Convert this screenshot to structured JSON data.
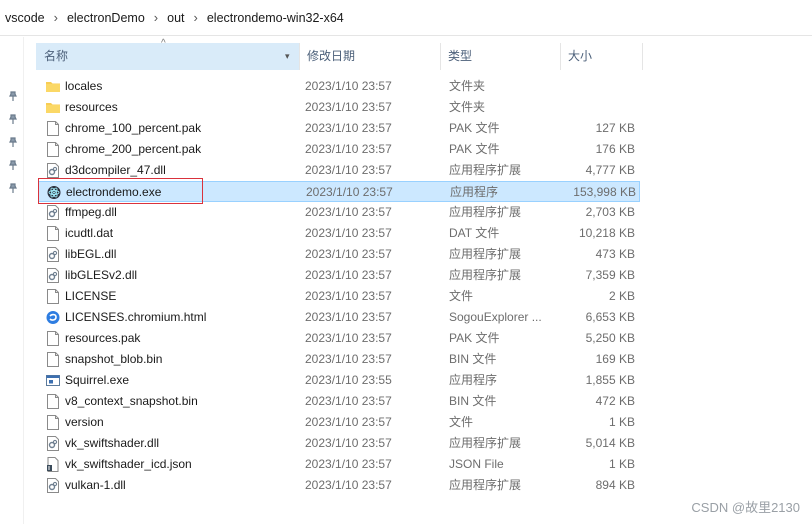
{
  "breadcrumb": [
    "vscode",
    "electronDemo",
    "out",
    "electrondemo-win32-x64"
  ],
  "breadcrumb_separator": "›",
  "header": {
    "name": "名称",
    "date": "修改日期",
    "type": "类型",
    "size": "大小"
  },
  "files": [
    {
      "name": "locales",
      "date": "2023/1/10 23:57",
      "type": "文件夹",
      "size": "",
      "icon": "folder-icon"
    },
    {
      "name": "resources",
      "date": "2023/1/10 23:57",
      "type": "文件夹",
      "size": "",
      "icon": "folder-icon"
    },
    {
      "name": "chrome_100_percent.pak",
      "date": "2023/1/10 23:57",
      "type": "PAK 文件",
      "size": "127 KB",
      "icon": "file-icon"
    },
    {
      "name": "chrome_200_percent.pak",
      "date": "2023/1/10 23:57",
      "type": "PAK 文件",
      "size": "176 KB",
      "icon": "file-icon"
    },
    {
      "name": "d3dcompiler_47.dll",
      "date": "2023/1/10 23:57",
      "type": "应用程序扩展",
      "size": "4,777 KB",
      "icon": "dll-icon"
    },
    {
      "name": "electrondemo.exe",
      "date": "2023/1/10 23:57",
      "type": "应用程序",
      "size": "153,998 KB",
      "icon": "electron-app-icon",
      "selected": true
    },
    {
      "name": "ffmpeg.dll",
      "date": "2023/1/10 23:57",
      "type": "应用程序扩展",
      "size": "2,703 KB",
      "icon": "dll-icon"
    },
    {
      "name": "icudtl.dat",
      "date": "2023/1/10 23:57",
      "type": "DAT 文件",
      "size": "10,218 KB",
      "icon": "file-icon"
    },
    {
      "name": "libEGL.dll",
      "date": "2023/1/10 23:57",
      "type": "应用程序扩展",
      "size": "473 KB",
      "icon": "dll-icon"
    },
    {
      "name": "libGLESv2.dll",
      "date": "2023/1/10 23:57",
      "type": "应用程序扩展",
      "size": "7,359 KB",
      "icon": "dll-icon"
    },
    {
      "name": "LICENSE",
      "date": "2023/1/10 23:57",
      "type": "文件",
      "size": "2 KB",
      "icon": "file-icon"
    },
    {
      "name": "LICENSES.chromium.html",
      "date": "2023/1/10 23:57",
      "type": "SogouExplorer ...",
      "size": "6,653 KB",
      "icon": "browser-icon"
    },
    {
      "name": "resources.pak",
      "date": "2023/1/10 23:57",
      "type": "PAK 文件",
      "size": "5,250 KB",
      "icon": "file-icon"
    },
    {
      "name": "snapshot_blob.bin",
      "date": "2023/1/10 23:57",
      "type": "BIN 文件",
      "size": "169 KB",
      "icon": "file-icon"
    },
    {
      "name": "Squirrel.exe",
      "date": "2023/1/10 23:55",
      "type": "应用程序",
      "size": "1,855 KB",
      "icon": "exe-icon"
    },
    {
      "name": "v8_context_snapshot.bin",
      "date": "2023/1/10 23:57",
      "type": "BIN 文件",
      "size": "472 KB",
      "icon": "file-icon"
    },
    {
      "name": "version",
      "date": "2023/1/10 23:57",
      "type": "文件",
      "size": "1 KB",
      "icon": "file-icon"
    },
    {
      "name": "vk_swiftshader.dll",
      "date": "2023/1/10 23:57",
      "type": "应用程序扩展",
      "size": "5,014 KB",
      "icon": "dll-icon"
    },
    {
      "name": "vk_swiftshader_icd.json",
      "date": "2023/1/10 23:57",
      "type": "JSON File",
      "size": "1 KB",
      "icon": "json-icon"
    },
    {
      "name": "vulkan-1.dll",
      "date": "2023/1/10 23:57",
      "type": "应用程序扩展",
      "size": "894 KB",
      "icon": "dll-icon"
    }
  ],
  "watermark": "CSDN @故里2130",
  "colors": {
    "selected_bg": "#cce8ff",
    "selected_border": "#99d1ff",
    "highlight_box": "#d9323c",
    "header_active_bg": "#d9ebf9",
    "folder": "#f8cd54"
  }
}
